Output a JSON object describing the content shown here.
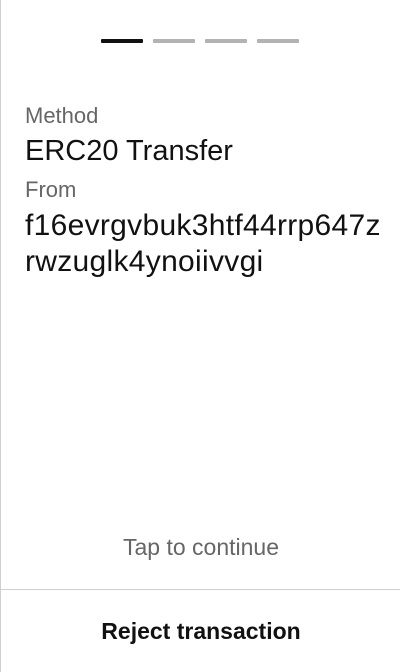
{
  "progress": {
    "total_steps": 4,
    "current_step": 1
  },
  "details": {
    "method_label": "Method",
    "method_value": "ERC20 Transfer",
    "from_label": "From",
    "from_value": "f16evrgvbuk3htf44rrp647zrwzuglk4ynoiivvgi"
  },
  "hint": {
    "text": "Tap to continue"
  },
  "actions": {
    "reject_label": "Reject transaction"
  },
  "colors": {
    "active_step": "#111111",
    "inactive_step": "#b3b3b3",
    "label_text": "#666666",
    "value_text": "#111111",
    "divider": "#cfcfcf"
  }
}
